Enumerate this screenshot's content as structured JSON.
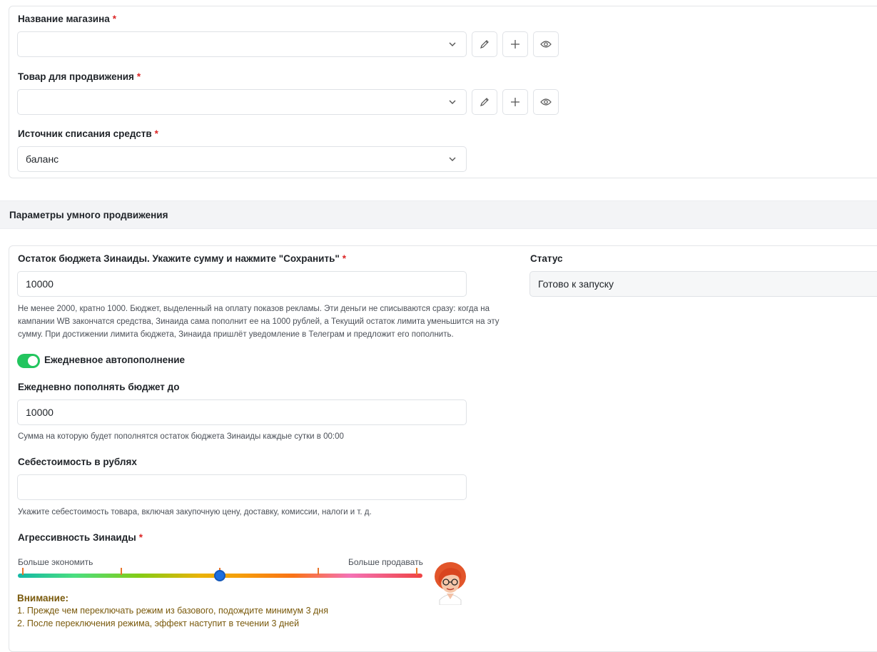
{
  "store": {
    "label": "Название магазина",
    "required": "*",
    "value": ""
  },
  "product": {
    "label": "Товар для продвижения",
    "required": "*",
    "value": ""
  },
  "source": {
    "label": "Источник списания средств",
    "required": "*",
    "value": "баланс"
  },
  "section": {
    "title": "Параметры умного продвижения"
  },
  "budget": {
    "label": "Остаток бюджета Зинаиды. Укажите сумму и нажмите \"Сохранить\"",
    "required": "*",
    "value": "10000",
    "hint": "Не менее 2000, кратно 1000. Бюджет, выделенный на оплату показов рекламы. Эти деньги не списываются сразу: когда на кампании WB закончатся средства, Зинаида сама пополнит ее на 1000 рублей, а Текущий остаток лимита уменьшится на эту сумму. При достижении лимита бюджета, Зинаида пришлёт уведомление в Телеграм и предложит его пополнить."
  },
  "status": {
    "label": "Статус",
    "value": "Готово к запуску"
  },
  "autorefill": {
    "label": "Ежедневное автопополнение",
    "enabled": true
  },
  "daily": {
    "label": "Ежедневно пополнять бюджет до",
    "value": "10000",
    "hint": "Сумма на которую будет пополнятся остаток бюджета Зинаиды каждые сутки в 00:00"
  },
  "cost": {
    "label": "Себестоимость в рублях",
    "value": "",
    "hint": "Укажите себестоимость товара, включая закупочную цену, доставку, комиссии, налоги и т. д."
  },
  "aggression": {
    "label": "Агрессивность Зинаиды",
    "required": "*",
    "left_caption": "Больше экономить",
    "right_caption": "Больше продавать",
    "level_fraction": 0.5
  },
  "warning": {
    "title": "Внимание:",
    "lines": [
      "1. Прежде чем переключать режим из базового, подождите минимум 3 дня",
      "2. После переключения режима, эффект наступит в течении 3 дней"
    ]
  },
  "colors": {
    "accent": "#1d6fe0",
    "toggle_on": "#22c55e",
    "required": "#dc2626",
    "warning_text": "#7a5a0c"
  }
}
